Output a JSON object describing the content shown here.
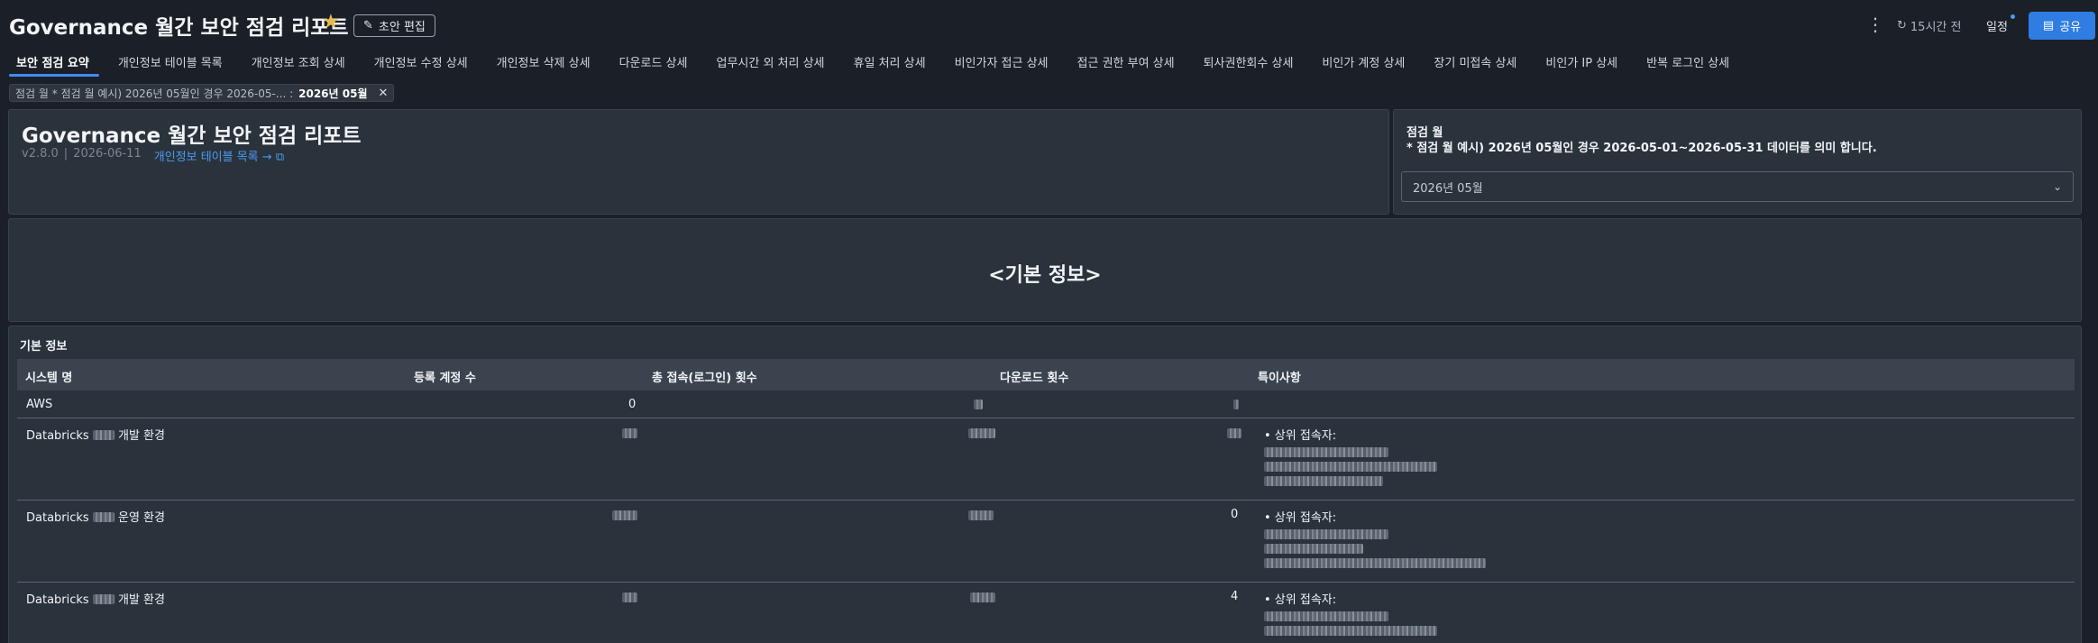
{
  "header": {
    "title": "Governance 월간 보안 점검 리포트",
    "draft_edit_label": "초안 편집",
    "refresh_label": "15시간 전",
    "schedule_label": "일정",
    "share_label": "공유"
  },
  "tabs": [
    {
      "label": "보안 점검 요약",
      "active": true
    },
    {
      "label": "개인정보 테이블 목록"
    },
    {
      "label": "개인정보 조회 상세"
    },
    {
      "label": "개인정보 수정 상세"
    },
    {
      "label": "개인정보 삭제 상세"
    },
    {
      "label": "다운로드 상세"
    },
    {
      "label": "업무시간 외 처리 상세"
    },
    {
      "label": "휴일 처리 상세"
    },
    {
      "label": "비인가자 접근 상세"
    },
    {
      "label": "접근 권한 부여 상세"
    },
    {
      "label": "퇴사권한회수 상세"
    },
    {
      "label": "비인가 계정 상세"
    },
    {
      "label": "장기 미접속 상세"
    },
    {
      "label": "비인가 IP 상세"
    },
    {
      "label": "반복 로그인 상세"
    }
  ],
  "filter_chip": {
    "label": "점검 월 * 점검 월 예시) 2026년 05월인 경우 2026-05-... :",
    "value": "2026년 05월"
  },
  "report": {
    "title": "Governance 월간 보안 점검 리포트",
    "version": "v2.8.0",
    "separator": "|",
    "date": "2026-06-11",
    "link_label": "개인정보 테이블 목록 →"
  },
  "month_filter": {
    "label": "점검 월",
    "description": "* 점검 월 예시) 2026년 05월인 경우 2026-05-01~2026-05-31 데이터를 의미 합니다.",
    "selected": "2026년 05월"
  },
  "basic_section": {
    "heading": "<기본 정보>"
  },
  "table": {
    "caption": "기본 정보",
    "columns": [
      "시스템 명",
      "등록 계정 수",
      "총 접속(로그인) 횟수",
      "다운로드 횟수",
      "특이사항"
    ],
    "rows": [
      {
        "system": "AWS",
        "accounts": "0",
        "logins": "",
        "downloads": "",
        "notes_title": ""
      },
      {
        "system": "Databricks",
        "system_suffix": "개발 환경",
        "accounts": "",
        "logins": "",
        "downloads": "",
        "notes_title": "• 상위 접속자:"
      },
      {
        "system": "Databricks",
        "system_suffix": "운영 환경",
        "accounts": "",
        "logins": "",
        "downloads": "0",
        "notes_title": "• 상위 접속자:"
      },
      {
        "system": "Databricks",
        "system_suffix": "개발 환경",
        "accounts": "",
        "logins": "",
        "downloads": "4",
        "notes_title": "• 상위 접속자:"
      }
    ]
  }
}
